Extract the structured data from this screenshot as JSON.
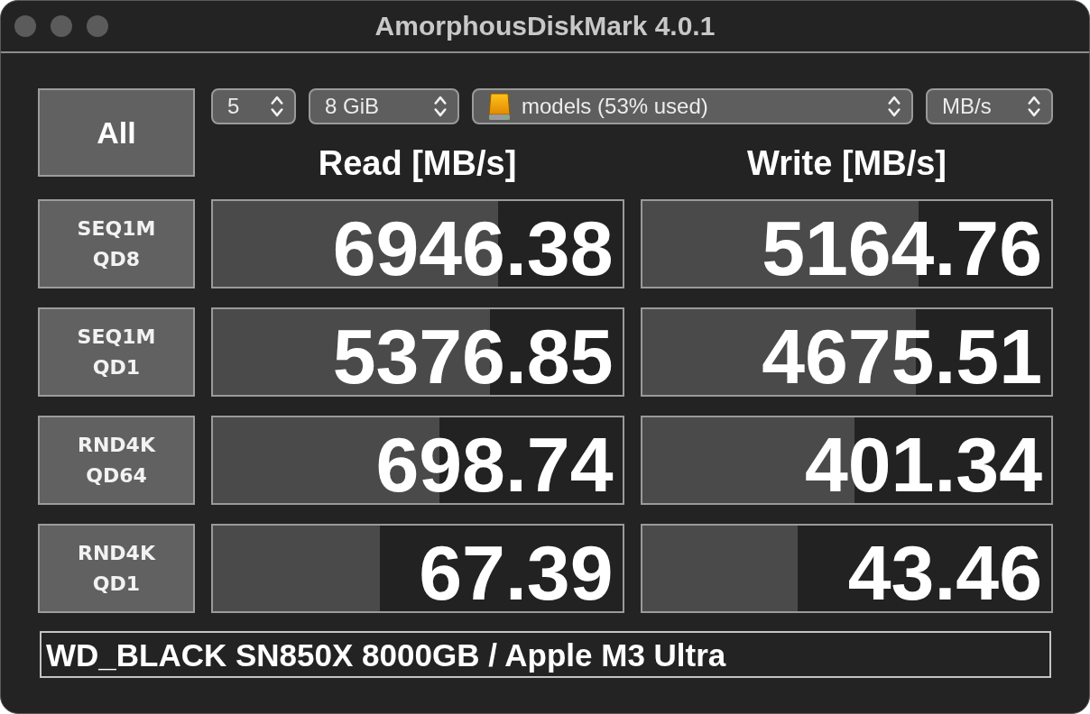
{
  "window": {
    "title": "AmorphousDiskMark 4.0.1"
  },
  "all_button": {
    "label": "All"
  },
  "selects": [
    {
      "kind": "plain",
      "value": "5"
    },
    {
      "kind": "plain",
      "value": "8 GiB"
    },
    {
      "kind": "drive",
      "value": "models (53% used)"
    },
    {
      "kind": "plain",
      "value": "MB/s"
    }
  ],
  "column_headers": [
    "Read [MB/s]",
    "Write [MB/s]"
  ],
  "rows": [
    {
      "label_lines": [
        "SEQ1M",
        "QD8"
      ],
      "read": {
        "value": "6946.38",
        "level": 0.696
      },
      "write": {
        "value": "5164.76",
        "level": 0.676
      }
    },
    {
      "label_lines": [
        "SEQ1M",
        "QD1"
      ],
      "read": {
        "value": "5376.85",
        "level": 0.678
      },
      "write": {
        "value": "4675.51",
        "level": 0.67
      }
    },
    {
      "label_lines": [
        "RND4K",
        "QD64"
      ],
      "read": {
        "value": "698.74",
        "level": 0.554
      },
      "write": {
        "value": "401.34",
        "level": 0.519
      }
    },
    {
      "label_lines": [
        "RND4K",
        "QD1"
      ],
      "read": {
        "value": "67.39",
        "level": 0.407
      },
      "write": {
        "value": "43.46",
        "level": 0.381
      }
    }
  ],
  "comment": {
    "value": "WD_BLACK SN850X 8000GB / Apple M3 Ultra"
  }
}
